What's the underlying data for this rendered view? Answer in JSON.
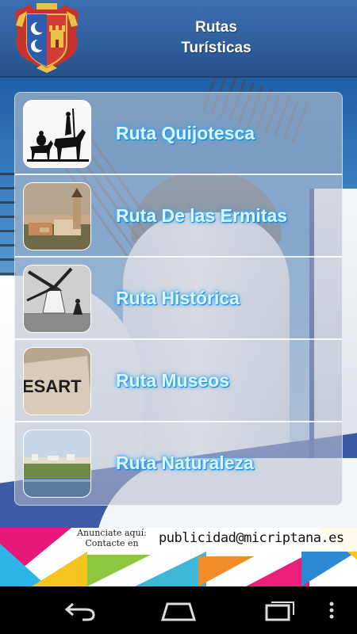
{
  "header": {
    "title_line1": "Rutas",
    "title_line2": "Turísticas",
    "crest_icon": "coat-of-arms-icon"
  },
  "routes": [
    {
      "label": "Ruta Quijotesca",
      "thumb_icon": "don-quixote-silhouette"
    },
    {
      "label": "Ruta De las Ermitas",
      "thumb_icon": "town-church-photo"
    },
    {
      "label": "Ruta Histórica",
      "thumb_icon": "windmill-photo"
    },
    {
      "label": "Ruta Museos",
      "thumb_icon": "museum-sign-photo",
      "thumb_text": "ESART"
    },
    {
      "label": "Ruta Naturaleza",
      "thumb_icon": "landscape-photo"
    }
  ],
  "ad": {
    "line1": "Anunciate aquí:",
    "line2": "Contacte en",
    "email": "publicidad@micriptana.es"
  },
  "navbar": {
    "back_icon": "back-icon",
    "home_icon": "home-icon",
    "recents_icon": "recent-apps-icon",
    "menu_icon": "overflow-menu-icon"
  },
  "colors": {
    "header": "#2f5e9c",
    "route_text": "#dff4ff",
    "route_glow": "#1aa0ff"
  }
}
